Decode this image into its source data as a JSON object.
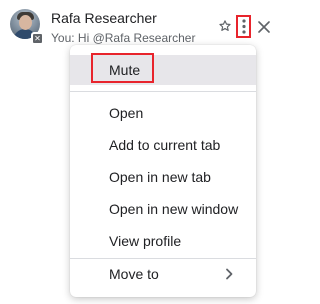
{
  "header": {
    "contact_name": "Rafa Researcher",
    "last_message": "You: Hi @Rafa Researcher",
    "status_badge_glyph": "✕",
    "icons": {
      "star": "star-outline-icon",
      "more": "more-vert-icon",
      "close": "close-icon"
    }
  },
  "menu": {
    "items": [
      {
        "label": "Mute"
      },
      {
        "label": "Open"
      },
      {
        "label": "Add to current tab"
      },
      {
        "label": "Open in new tab"
      },
      {
        "label": "Open in new window"
      },
      {
        "label": "View profile"
      },
      {
        "label": "Move to"
      }
    ],
    "active_index": 0
  },
  "colors": {
    "highlight": "#e8242c",
    "text_primary": "#202124",
    "text_secondary": "#5f6368",
    "menu_active_bg": "#e7e6ea",
    "divider": "#dadce0"
  }
}
